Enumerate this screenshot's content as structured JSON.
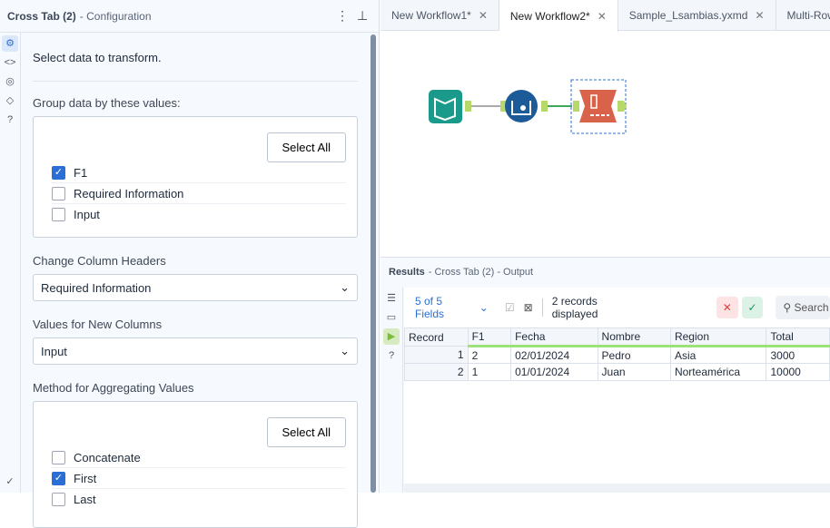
{
  "config": {
    "title": "Cross Tab (2)",
    "subtitle": "- Configuration",
    "intro": "Select data to transform.",
    "group_label": "Group data by these values:",
    "select_all": "Select All",
    "group_fields": [
      {
        "label": "F1",
        "checked": true
      },
      {
        "label": "Required Information",
        "checked": false
      },
      {
        "label": "Input",
        "checked": false
      }
    ],
    "headers_label": "Change Column Headers",
    "headers_value": "Required Information",
    "values_label": "Values for New Columns",
    "values_value": "Input",
    "method_label": "Method for Aggregating Values",
    "methods": [
      {
        "label": "Concatenate",
        "checked": false
      },
      {
        "label": "First",
        "checked": true
      },
      {
        "label": "Last",
        "checked": false
      }
    ]
  },
  "tabs": [
    {
      "label": "New Workflow1*",
      "active": false
    },
    {
      "label": "New Workflow2*",
      "active": true
    },
    {
      "label": "Sample_Lsambias.yxmd",
      "active": false
    },
    {
      "label": "Multi-Row_Fo",
      "active": false
    }
  ],
  "results": {
    "title": "Results",
    "subtitle": "- Cross Tab (2) - Output",
    "fields": "5 of 5 Fields",
    "count": "2 records displayed",
    "search": "Search",
    "columns": [
      "Record",
      "F1",
      "Fecha",
      "Nombre",
      "Region",
      "Total"
    ],
    "rows": [
      [
        "1",
        "2",
        "02/01/2024",
        "Pedro",
        "Asia",
        "3000"
      ],
      [
        "2",
        "1",
        "01/01/2024",
        "Juan",
        "Norteamérica",
        "10000"
      ]
    ]
  }
}
